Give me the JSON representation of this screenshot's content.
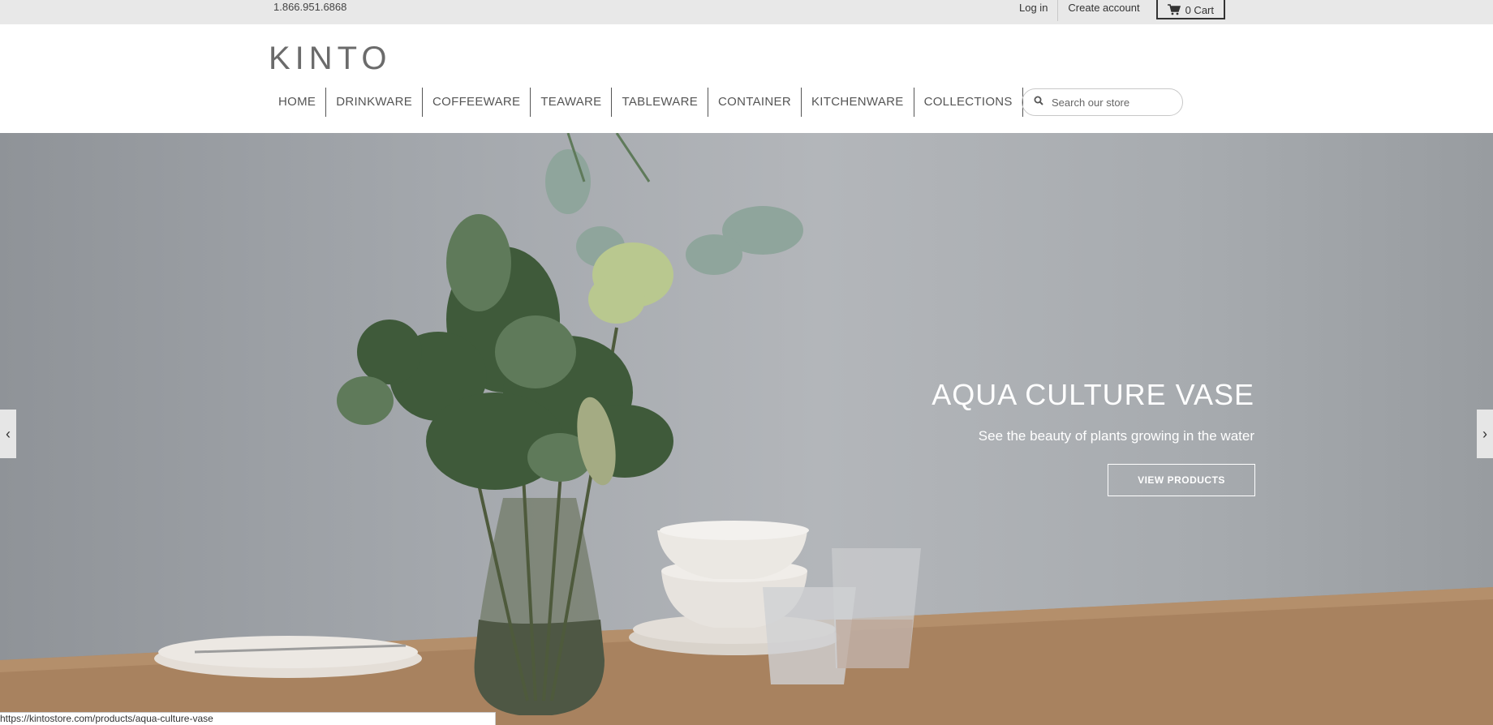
{
  "topbar": {
    "phone": "1.866.951.6868",
    "login_label": "Log in",
    "create_account_label": "Create account",
    "cart_label": "0 Cart"
  },
  "header": {
    "logo": "KINTO",
    "nav": [
      {
        "label": "HOME"
      },
      {
        "label": "DRINKWARE"
      },
      {
        "label": "COFFEEWARE"
      },
      {
        "label": "TEAWARE"
      },
      {
        "label": "TABLEWARE"
      },
      {
        "label": "CONTAINER"
      },
      {
        "label": "KITCHENWARE"
      },
      {
        "label": "COLLECTIONS"
      }
    ],
    "search": {
      "placeholder": "Search our store"
    }
  },
  "hero": {
    "title": "AQUA CULTURE VASE",
    "subtitle": "See the beauty of plants growing in the water",
    "button_label": "VIEW PRODUCTS",
    "prev_arrow": "‹",
    "next_arrow": "›"
  },
  "status_url": "https://kintostore.com/products/aqua-culture-vase",
  "colors": {
    "topbar_bg": "#e8e8e8",
    "hero_bg": "#a4a8ad",
    "table": "#a57f5f",
    "text_dark": "#333333"
  }
}
